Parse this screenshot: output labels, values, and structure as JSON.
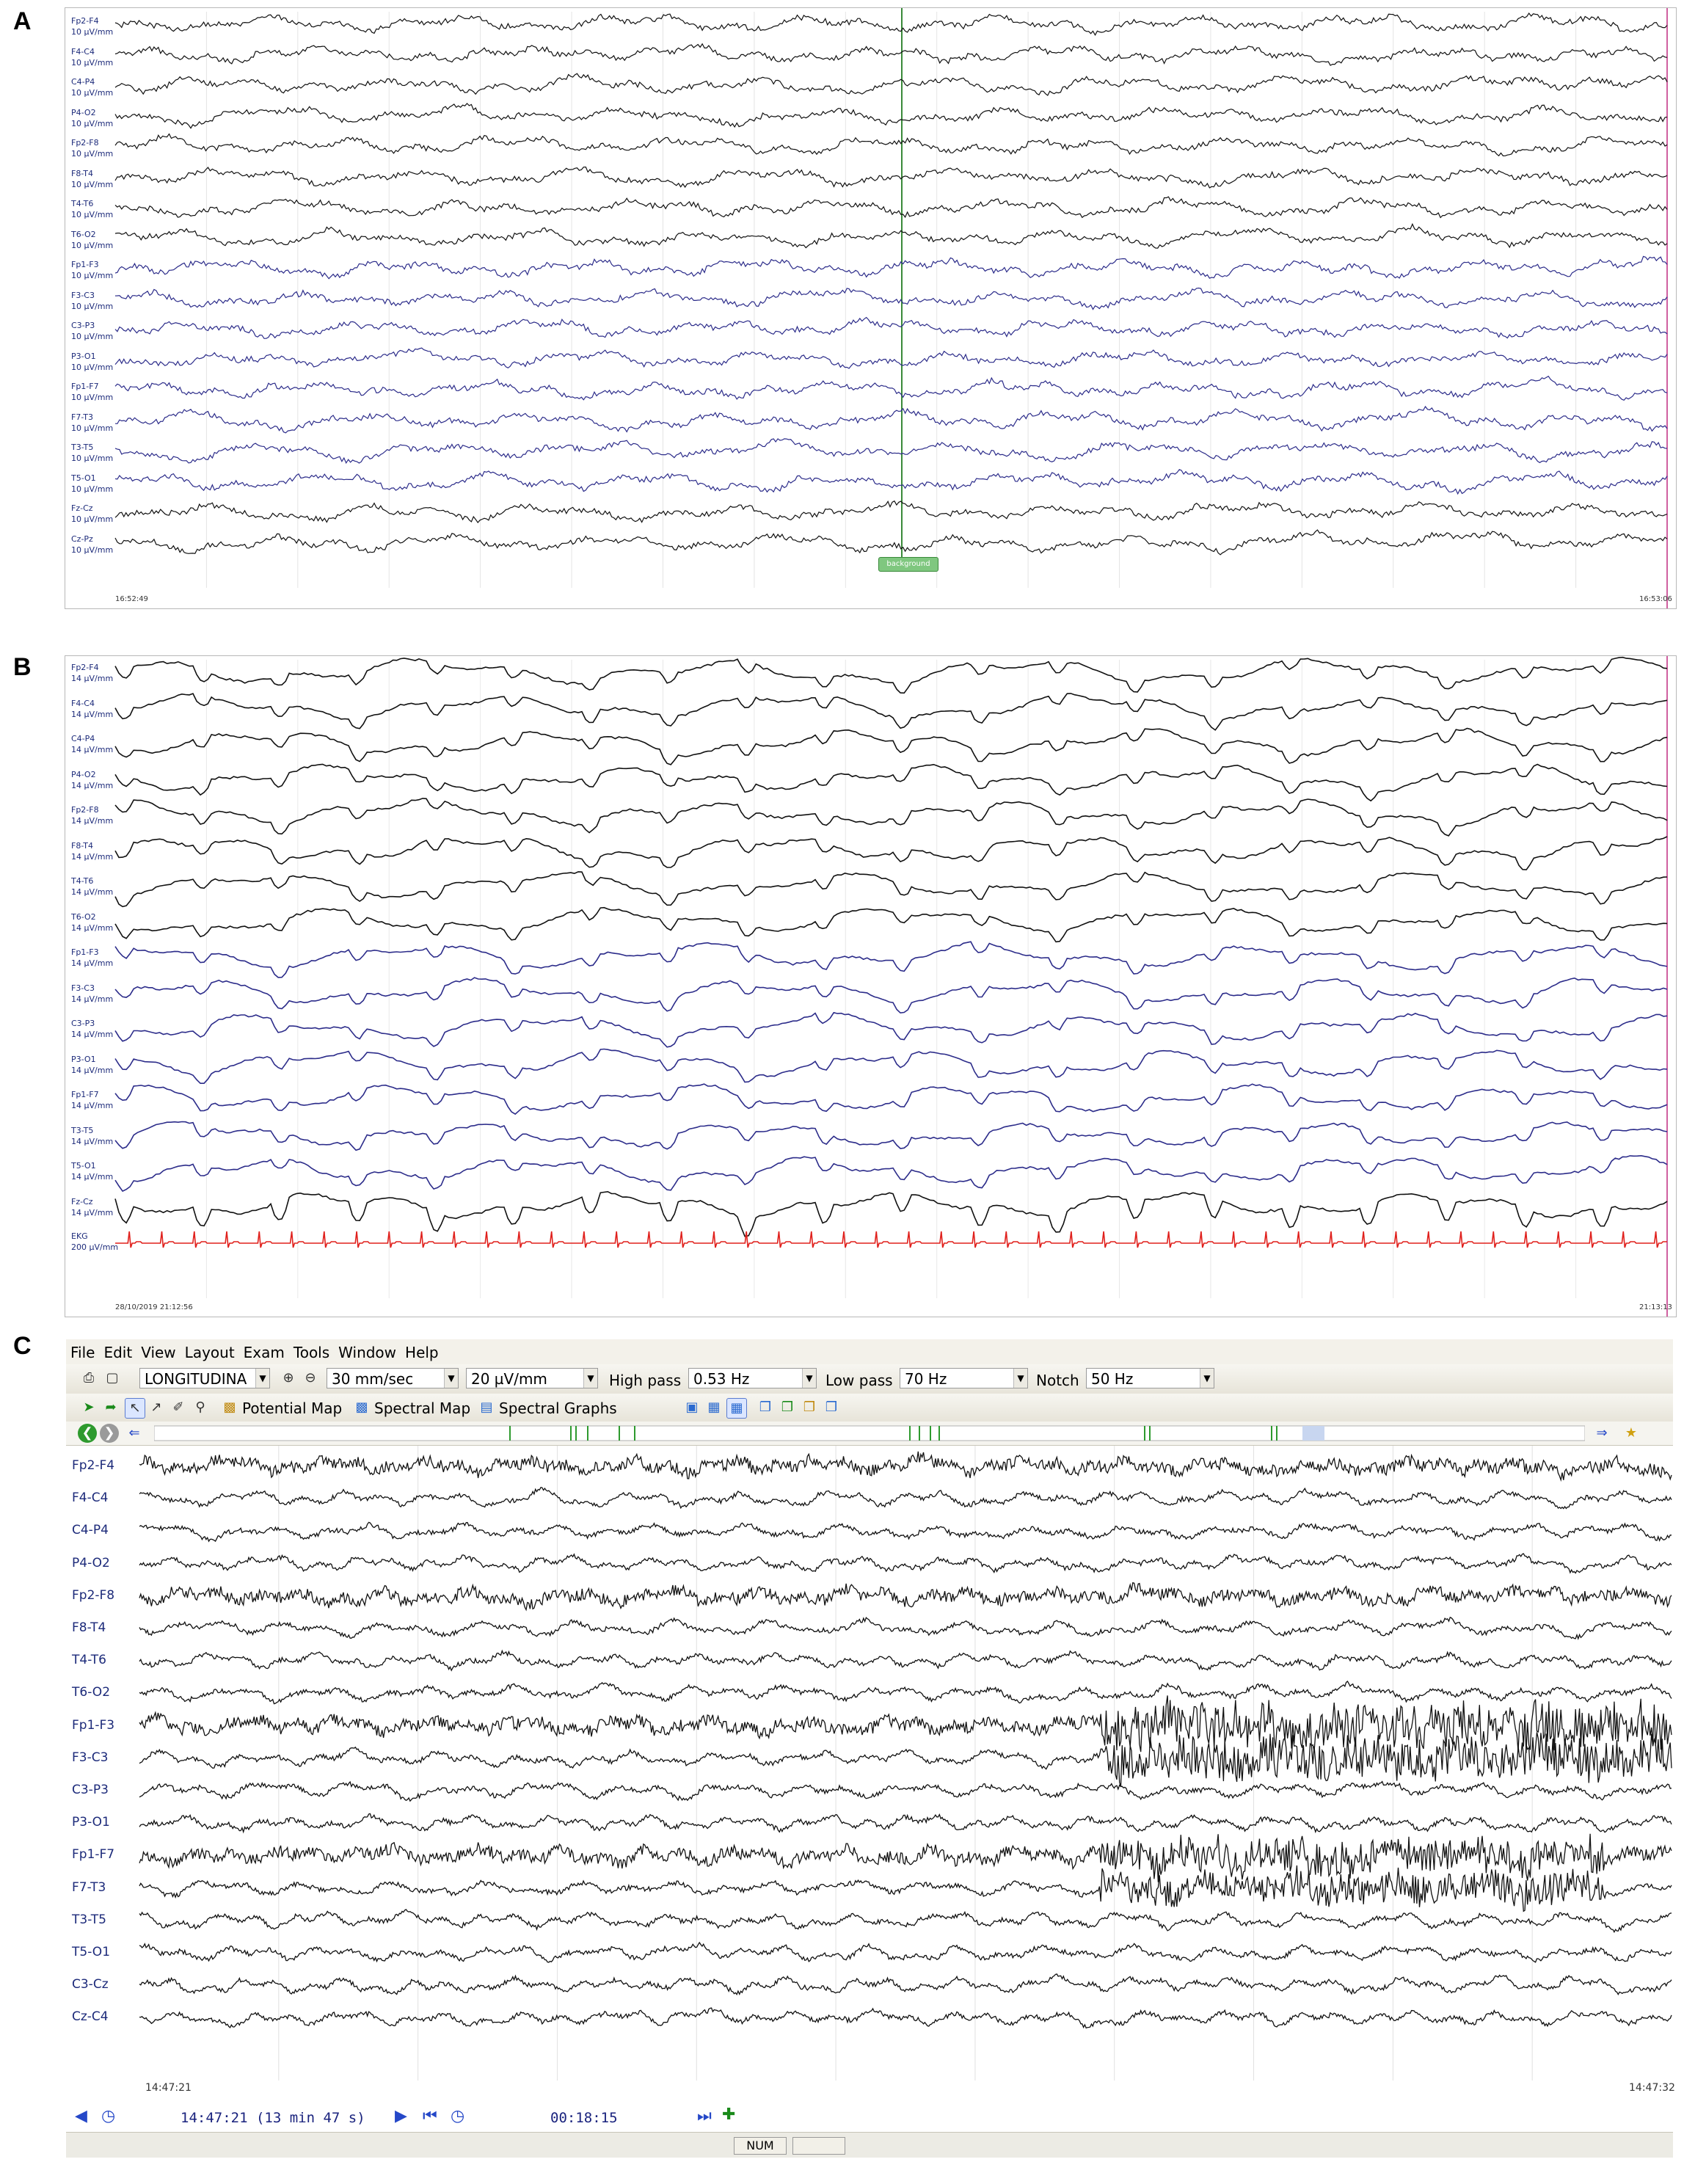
{
  "panel_labels": {
    "a": "A",
    "b": "B",
    "c": "C"
  },
  "panelA": {
    "channels": [
      "Fp2-F4",
      "F4-C4",
      "C4-P4",
      "P4-O2",
      "Fp2-F8",
      "F8-T4",
      "T4-T6",
      "T6-O2",
      "Fp1-F3",
      "F3-C3",
      "C3-P3",
      "P3-O1",
      "Fp1-F7",
      "F7-T3",
      "T3-T5",
      "T5-O1",
      "Fz-Cz",
      "Cz-Pz"
    ],
    "sensitivity": "10 µV/mm",
    "time_start": "16:52:49",
    "time_end": "16:53:06",
    "marker_label": "background"
  },
  "panelB": {
    "channels": [
      "Fp2-F4",
      "F4-C4",
      "C4-P4",
      "P4-O2",
      "Fp2-F8",
      "F8-T4",
      "T4-T6",
      "T6-O2",
      "Fp1-F3",
      "F3-C3",
      "C3-P3",
      "P3-O1",
      "Fp1-F7",
      "T3-T5",
      "T5-O1",
      "Fz-Cz"
    ],
    "sensitivity": "14 µV/mm",
    "ekg_label": "EKG",
    "ekg_sensitivity": "200 µV/mm",
    "time_start": "28/10/2019 21:12:56",
    "time_end": "21:13:13"
  },
  "panelC": {
    "menu": [
      "File",
      "Edit",
      "View",
      "Layout",
      "Exam",
      "Tools",
      "Window",
      "Help"
    ],
    "montage": "LONGITUDINA",
    "speed": "30 mm/sec",
    "sensitivity": "20 µV/mm",
    "high_pass_label": "High pass",
    "high_pass": "0.53 Hz",
    "low_pass_label": "Low pass",
    "low_pass": "70 Hz",
    "notch_label": "Notch",
    "notch": "50 Hz",
    "potential_map": "Potential Map",
    "spectral_map": "Spectral Map",
    "spectral_graphs": "Spectral Graphs",
    "channels": [
      "Fp2-F4",
      "F4-C4",
      "C4-P4",
      "P4-O2",
      "Fp2-F8",
      "F8-T4",
      "T4-T6",
      "T6-O2",
      "Fp1-F3",
      "F3-C3",
      "C3-P3",
      "P3-O1",
      "Fp1-F7",
      "F7-T3",
      "T3-T5",
      "T5-O1",
      "C3-Cz",
      "Cz-C4"
    ],
    "time_start": "14:47:21",
    "time_end": "14:47:32",
    "status_time": "14:47:21 (13 min 47 s)",
    "elapsed": "00:18:15",
    "num": "NUM"
  },
  "colors": {
    "trace_black": "#111111",
    "trace_blue": "#2c2c8a",
    "ekg_red": "#e0201c",
    "marker_green": "#3a8a3a",
    "label_blue": "#1c2a7a"
  },
  "icons": [
    "printer-icon",
    "preview-icon",
    "zoom-icon",
    "play-icon",
    "pointer-icon",
    "search-icon",
    "back-icon",
    "forward-icon",
    "arrow-left-icon",
    "arrow-right-icon",
    "first-page-icon",
    "last-page-icon",
    "clock-icon"
  ]
}
